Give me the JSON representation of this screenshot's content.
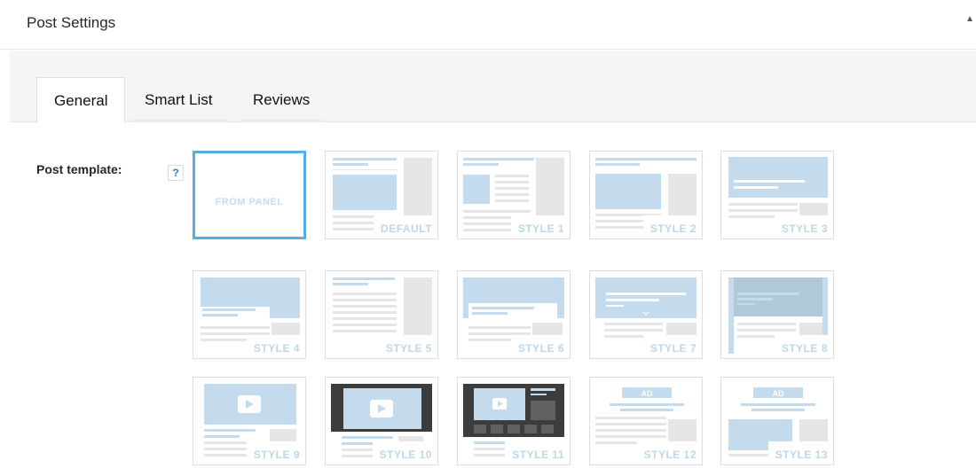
{
  "header": {
    "title": "Post Settings",
    "toggle_icon": "triangle-up-icon"
  },
  "tabs": [
    {
      "label": "General",
      "active": true
    },
    {
      "label": "Smart List",
      "active": false
    },
    {
      "label": "Reviews",
      "active": false
    }
  ],
  "field": {
    "label": "Post template:",
    "help": "?"
  },
  "colors": {
    "accent": "#55aee4",
    "thumb_blue": "#c3dbed",
    "thumb_gray": "#e6e6e6",
    "thumb_dark": "#3c3c3c"
  },
  "templates": [
    {
      "label": "FROM PANEL",
      "selected": true
    },
    {
      "label": "DEFAULT",
      "selected": false
    },
    {
      "label": "STYLE 1",
      "selected": false
    },
    {
      "label": "STYLE 2",
      "selected": false
    },
    {
      "label": "STYLE 3",
      "selected": false
    },
    {
      "label": "STYLE 4",
      "selected": false
    },
    {
      "label": "STYLE 5",
      "selected": false
    },
    {
      "label": "STYLE 6",
      "selected": false
    },
    {
      "label": "STYLE 7",
      "selected": false
    },
    {
      "label": "STYLE 8",
      "selected": false
    },
    {
      "label": "STYLE 9",
      "selected": false
    },
    {
      "label": "STYLE 10",
      "selected": false
    },
    {
      "label": "STYLE 11",
      "selected": false
    },
    {
      "label": "STYLE 12",
      "selected": false,
      "badge": "AD"
    },
    {
      "label": "STYLE 13",
      "selected": false,
      "badge": "AD"
    }
  ]
}
